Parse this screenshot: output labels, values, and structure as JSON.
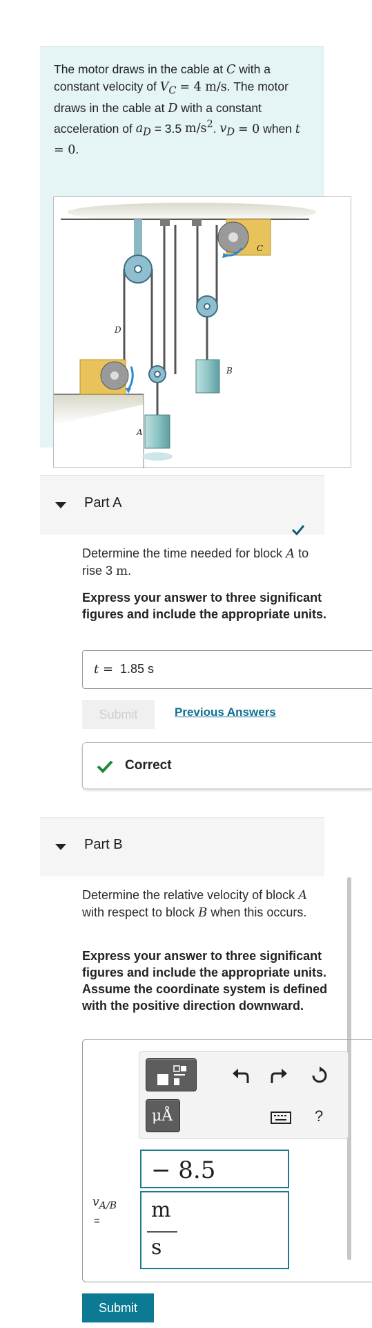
{
  "problem": {
    "text_html": "The motor draws in the cable at <i class=\"serif\">C</i> with a constant velocity of <i class=\"serif\">V<sub>C</sub></i> <span class=\"serif\">= 4 m/s</span>. The motor draws in the cable at <i class=\"serif\">D</i> with a constant acceleration of <i class=\"serif\">a<sub>D</sub></i> = 3.5 <span class=\"serif\">m/s<sup>2</sup></span>. <i class=\"serif\">v<sub>D</sub></i> <span class=\"serif\">= 0</span> when <i class=\"serif\">t</i> <span class=\"serif\">= 0</span>.",
    "figure_labels": {
      "a": "A",
      "b": "B",
      "c": "C",
      "d": "D"
    }
  },
  "part_a": {
    "header": "Part A",
    "question_html": "Determine the time needed for block <i class=\"serif\">A</i> to rise 3 <span class=\"serif\">m</span>.",
    "instructions": "Express your answer to three significant figures and include the appropriate units.",
    "answer_var": "t =",
    "answer_value": "1.85 s",
    "submit_label": "Submit",
    "previous_answers_label": "Previous Answers",
    "feedback_label": "Correct"
  },
  "part_b": {
    "header": "Part B",
    "question_html": "Determine the relative velocity of block <i class=\"serif\">A</i> with respect to block <i class=\"serif\">B</i> when this occurs.",
    "instructions": "Express your answer to three significant figures and include the appropriate units. Assume the coordinate system is defined with the positive direction downward.",
    "value": "− 8.5",
    "unit_numerator": "m",
    "unit_denominator": "s",
    "var_label_html": "<i class=\"serif\">v<sub>A/B</sub></i>",
    "equals": "=",
    "units_button_label": "μÅ",
    "help_label": "?",
    "submit_label": "Submit"
  },
  "icons": [
    "templates-icon",
    "units-icon",
    "undo-icon",
    "redo-icon",
    "reset-icon",
    "keyboard-icon",
    "help-icon",
    "checkmark-icon"
  ],
  "colors": {
    "accent": "#0d7a93",
    "correct": "#1a8a3a",
    "problem_bg": "#e5f4f4"
  }
}
